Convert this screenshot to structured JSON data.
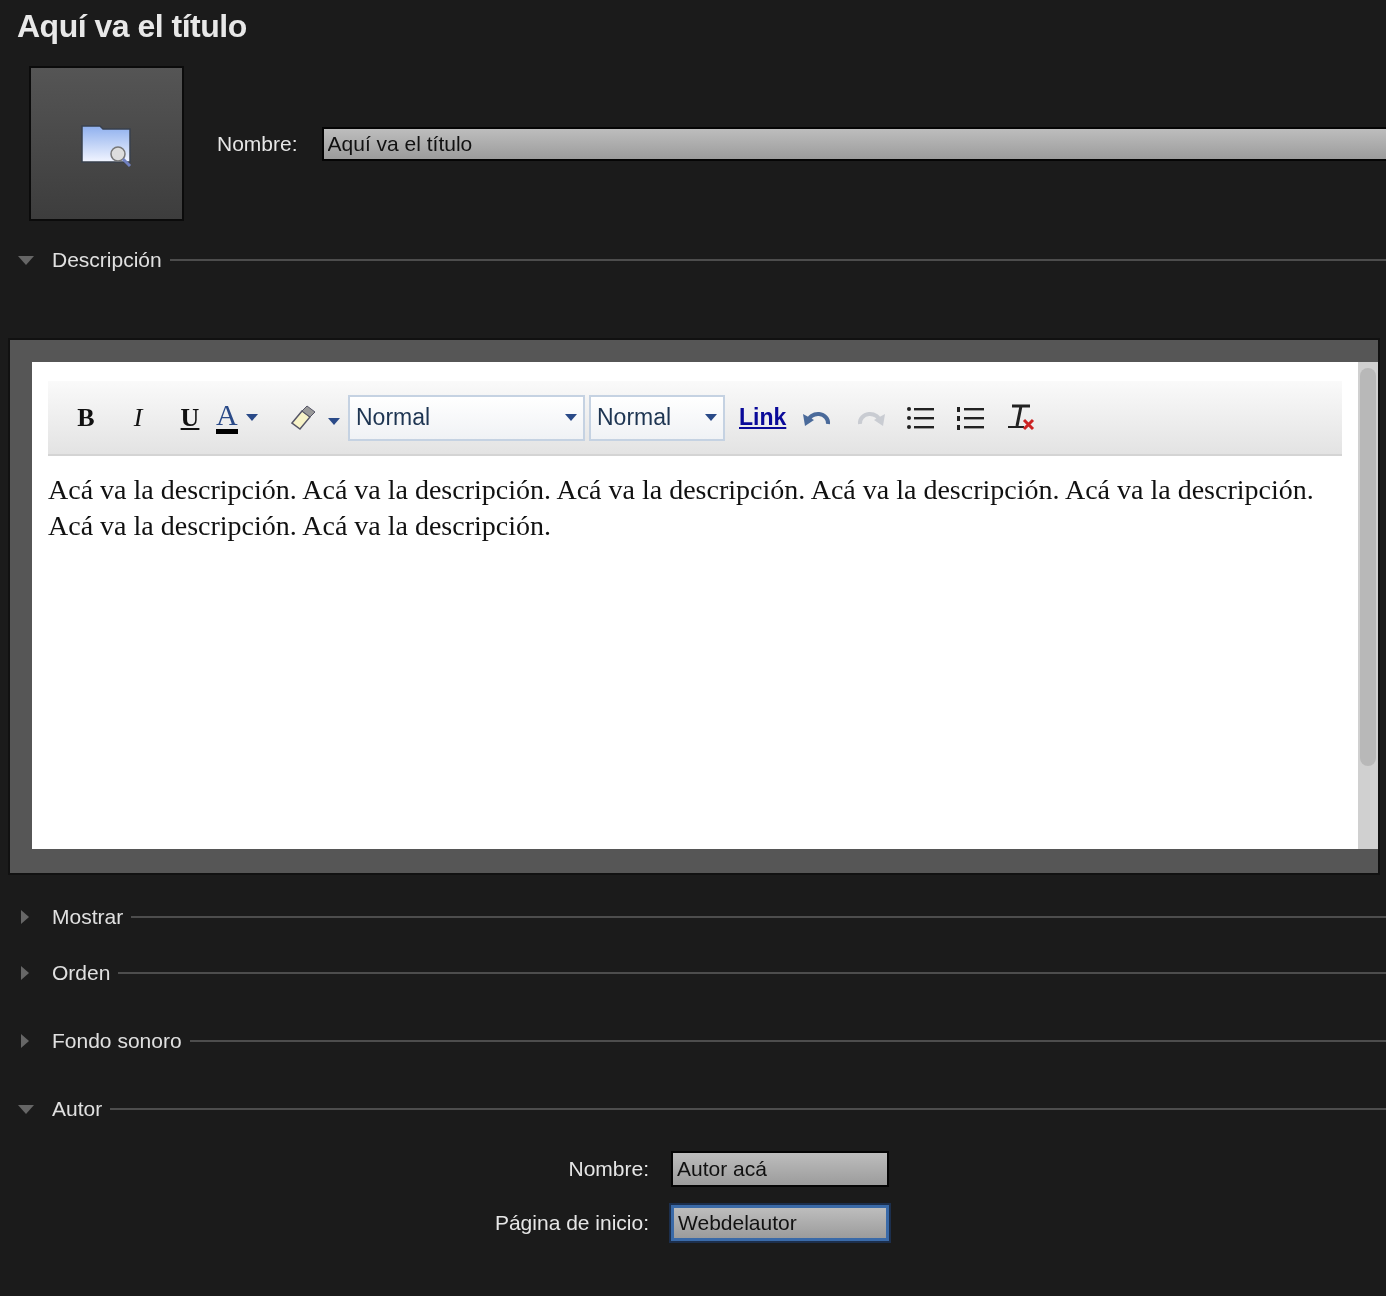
{
  "title": "Aquí va el título",
  "name_field": {
    "label": "Nombre:",
    "value": "Aquí va el título"
  },
  "sections": [
    {
      "label": "Descripción",
      "expanded": true,
      "kind": "editor",
      "toolbar": [
        {
          "kind": "bold",
          "text": "B"
        },
        {
          "kind": "italic",
          "text": "I"
        },
        {
          "kind": "underline",
          "text": "U"
        },
        {
          "kind": "text-color",
          "text": "A"
        },
        {
          "kind": "highlight"
        },
        {
          "kind": "dropdown",
          "text": "Normal",
          "wide": true
        },
        {
          "kind": "dropdown",
          "text": "Normal",
          "wide": false
        },
        {
          "kind": "link",
          "text": "Link"
        },
        {
          "kind": "undo",
          "disabled": false
        },
        {
          "kind": "redo",
          "disabled": true
        },
        {
          "kind": "bullets"
        },
        {
          "kind": "numbering"
        },
        {
          "kind": "clear-format"
        }
      ],
      "content": "Acá va la descripción. Acá va la descripción. Acá va la descripción. Acá va la descripción. Acá va la descripción. Acá va la descripción. Acá va la descripción."
    },
    {
      "label": "Mostrar",
      "expanded": false,
      "kind": "plain"
    },
    {
      "label": "Orden",
      "expanded": false,
      "kind": "plain"
    },
    {
      "label": "Fondo sonoro",
      "expanded": false,
      "kind": "plain"
    },
    {
      "label": "Autor",
      "expanded": true,
      "kind": "fields",
      "fields": [
        {
          "label": "Nombre:",
          "value": "Autor acá",
          "focused": false
        },
        {
          "label": "Página de inicio:",
          "value": "Webdelautor",
          "focused": true
        }
      ]
    }
  ]
}
